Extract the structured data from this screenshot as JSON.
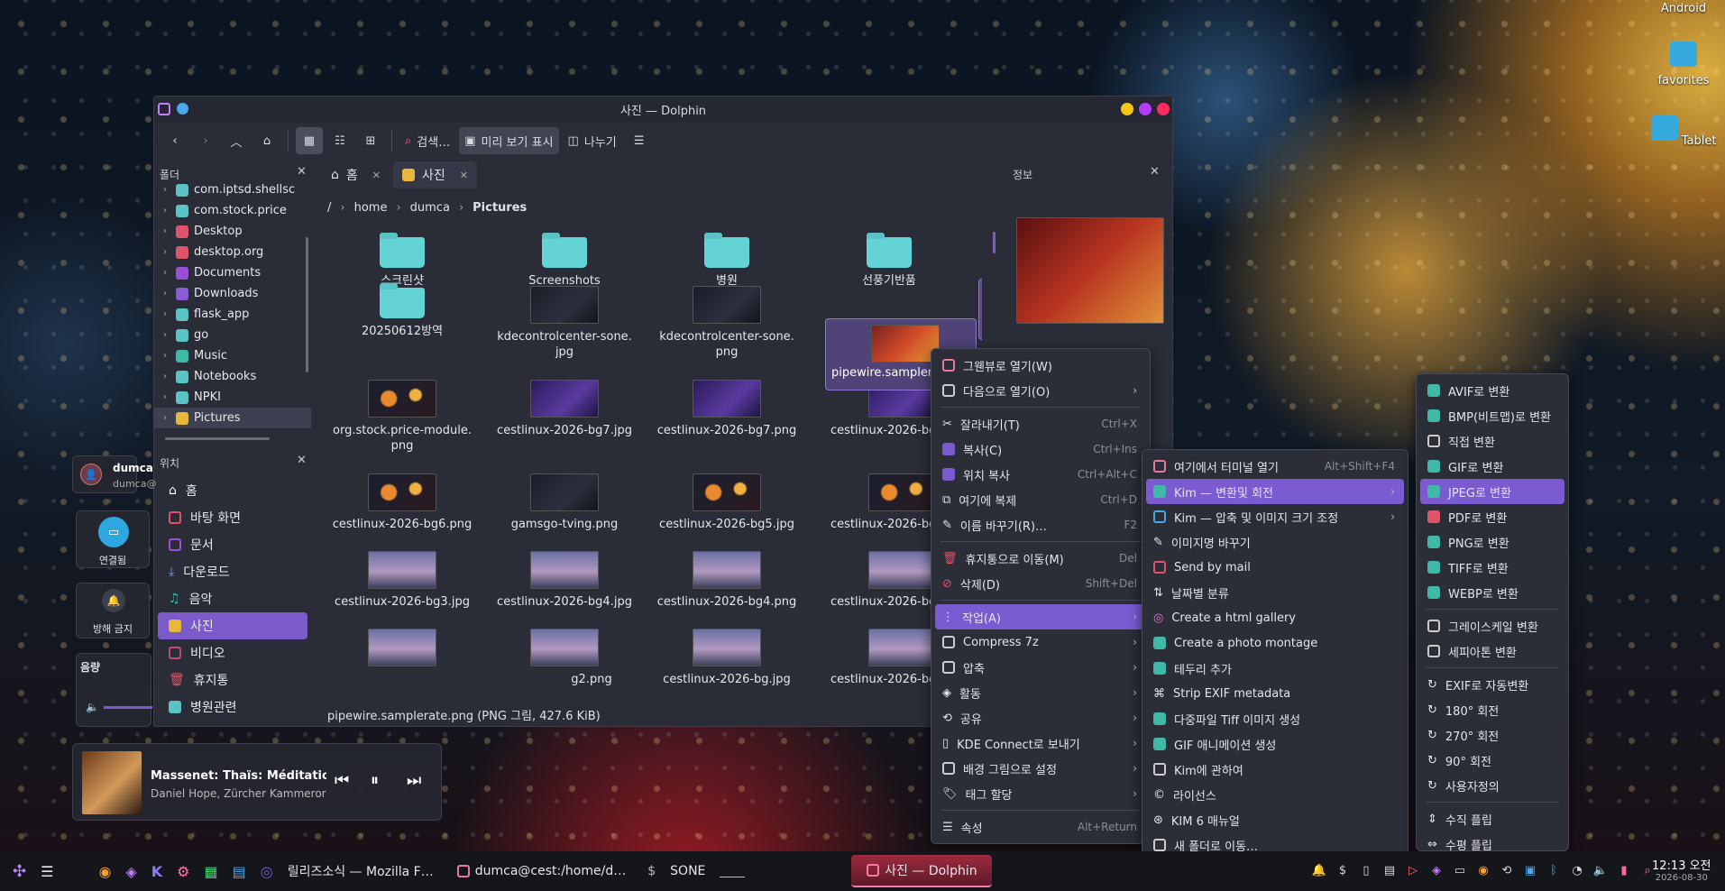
{
  "desktop": {
    "icons": [
      {
        "label": "Android"
      },
      {
        "label": "favorites"
      },
      {
        "label": "Tablet"
      }
    ]
  },
  "window": {
    "title": "사진 — Dolphin",
    "toolbar": {
      "search_label": "검색…",
      "preview_label": "미리 보기 표시",
      "split_label": "나누기"
    },
    "tabs": [
      {
        "label": "홈"
      },
      {
        "label": "사진"
      }
    ],
    "breadcrumb": [
      "/",
      "home",
      "dumca",
      "Pictures"
    ],
    "folders_panel": {
      "title": "폴더",
      "items": [
        {
          "label": "com.iptsd.shellsc"
        },
        {
          "label": "com.stock.price"
        },
        {
          "label": "Desktop"
        },
        {
          "label": "desktop.org"
        },
        {
          "label": "Documents"
        },
        {
          "label": "Downloads"
        },
        {
          "label": "flask_app"
        },
        {
          "label": "go"
        },
        {
          "label": "Music"
        },
        {
          "label": "Notebooks"
        },
        {
          "label": "NPKI"
        },
        {
          "label": "Pictures"
        }
      ]
    },
    "places_panel": {
      "title": "위치",
      "items": [
        {
          "label": "홈"
        },
        {
          "label": "바탕 화면"
        },
        {
          "label": "문서"
        },
        {
          "label": "다운로드"
        },
        {
          "label": "음악"
        },
        {
          "label": "사진"
        },
        {
          "label": "비디오"
        },
        {
          "label": "휴지통"
        },
        {
          "label": "병원관련"
        }
      ]
    },
    "files": [
      {
        "name": "스크린샷"
      },
      {
        "name": "Screenshots"
      },
      {
        "name": "병원"
      },
      {
        "name": "선풍기반품"
      },
      {
        "name": "20250612방역"
      },
      {
        "name": "kdecontrolcenter-sone.\njpg"
      },
      {
        "name": "kdecontrolcenter-sone.\npng"
      },
      {
        "name": "pipewire.samplera"
      },
      {
        "name": "org.stock.price-module.\npng"
      },
      {
        "name": "cestlinux-2026-bg7.jpg"
      },
      {
        "name": "cestlinux-2026-bg7.png"
      },
      {
        "name": "cestlinux-2026-bg"
      },
      {
        "name": "cestlinux-2026-bg6.png"
      },
      {
        "name": "gamsgo-tving.png"
      },
      {
        "name": "cestlinux-2026-bg5.jpg"
      },
      {
        "name": "cestlinux-2026-bg"
      },
      {
        "name": "cestlinux-2026-bg3.jpg"
      },
      {
        "name": "cestlinux-2026-bg4.jpg"
      },
      {
        "name": "cestlinux-2026-bg4.png"
      },
      {
        "name": "cestlinux-2026-bg"
      },
      {
        "name": "g2.png"
      },
      {
        "name": "cestlinux-2026-bg.jpg"
      },
      {
        "name": "cestlinux-2026-bg"
      }
    ],
    "status": "pipewire.samplerate.png (PNG 그림, 427.6 KiB)",
    "info_panel": {
      "title": "정보",
      "filename_fragment": "e."
    }
  },
  "widgets": {
    "user": {
      "name": "dumca",
      "email": "dumca@"
    },
    "connect_label": "연결됨",
    "dnd_label": "방해 금지",
    "volume_label": "음량",
    "media": {
      "title": "Massenet: Thaïs: Méditation (Ar…",
      "artist": "Daniel Hope, Zürcher Kammerorc…"
    }
  },
  "context_menu": {
    "items": [
      {
        "label": "그웬뷰로 열기(W)",
        "shortcut": "",
        "submenu": false
      },
      {
        "label": "다음으로 열기(O)",
        "shortcut": "",
        "submenu": true
      },
      {
        "label": "잘라내기(T)",
        "shortcut": "Ctrl+X",
        "submenu": false
      },
      {
        "label": "복사(C)",
        "shortcut": "Ctrl+Ins",
        "submenu": false
      },
      {
        "label": "위치 복사",
        "shortcut": "Ctrl+Alt+C",
        "submenu": false
      },
      {
        "label": "여기에 복제",
        "shortcut": "Ctrl+D",
        "submenu": false
      },
      {
        "label": "이름 바꾸기(R)…",
        "shortcut": "F2",
        "submenu": false
      },
      {
        "label": "휴지통으로 이동(M)",
        "shortcut": "Del",
        "submenu": false
      },
      {
        "label": "삭제(D)",
        "shortcut": "Shift+Del",
        "submenu": false
      },
      {
        "label": "작업(A)",
        "shortcut": "",
        "submenu": true
      },
      {
        "label": "Compress 7z",
        "shortcut": "",
        "submenu": true
      },
      {
        "label": "압축",
        "shortcut": "",
        "submenu": true
      },
      {
        "label": "활동",
        "shortcut": "",
        "submenu": true
      },
      {
        "label": "공유",
        "shortcut": "",
        "submenu": true
      },
      {
        "label": "KDE Connect로 보내기",
        "shortcut": "",
        "submenu": true
      },
      {
        "label": "배경 그림으로 설정",
        "shortcut": "",
        "submenu": true
      },
      {
        "label": "태그 할당",
        "shortcut": "",
        "submenu": true
      },
      {
        "label": "속성",
        "shortcut": "Alt+Return",
        "submenu": false
      }
    ]
  },
  "actions_menu": {
    "items": [
      {
        "label": "여기에서 터미널 열기",
        "shortcut": "Alt+Shift+F4"
      },
      {
        "label": "Kim — 변환및 회전",
        "shortcut": ""
      },
      {
        "label": "Kim — 압축 및 이미지 크기 조정",
        "shortcut": ""
      },
      {
        "label": "이미지명 바꾸기",
        "shortcut": ""
      },
      {
        "label": "Send by mail",
        "shortcut": ""
      },
      {
        "label": "날짜별 분류",
        "shortcut": ""
      },
      {
        "label": "Create a html gallery",
        "shortcut": ""
      },
      {
        "label": "Create a photo montage",
        "shortcut": ""
      },
      {
        "label": "테두리 추가",
        "shortcut": ""
      },
      {
        "label": "Strip EXIF metadata",
        "shortcut": ""
      },
      {
        "label": "다중파일 Tiff 이미지 생성",
        "shortcut": ""
      },
      {
        "label": "GIF 애니메이션 생성",
        "shortcut": ""
      },
      {
        "label": "Kim에 관하여",
        "shortcut": ""
      },
      {
        "label": "라이선스",
        "shortcut": ""
      },
      {
        "label": "KIM 6 매뉴얼",
        "shortcut": ""
      },
      {
        "label": "새 폴더로 이동…",
        "shortcut": ""
      }
    ]
  },
  "convert_menu": {
    "items": [
      {
        "label": "AVIF로 변환"
      },
      {
        "label": "BMP(비트맵)로 변환"
      },
      {
        "label": "직접 변환"
      },
      {
        "label": "GIF로 변환"
      },
      {
        "label": "JPEG로 변환"
      },
      {
        "label": "PDF로 변환"
      },
      {
        "label": "PNG로 변환"
      },
      {
        "label": "TIFF로 변환"
      },
      {
        "label": "WEBP로 변환"
      },
      {
        "label": "그레이스케일 변환"
      },
      {
        "label": "세피아톤 변환"
      },
      {
        "label": "EXIF로 자동변환"
      },
      {
        "label": "180° 회전"
      },
      {
        "label": "270° 회전"
      },
      {
        "label": "90° 회전"
      },
      {
        "label": "사용자정의"
      },
      {
        "label": "수직 플립"
      },
      {
        "label": "수평 플립"
      }
    ]
  },
  "taskbar": {
    "tasks": [
      {
        "label": "릴리즈소식 — Mozilla F…"
      },
      {
        "label": "dumca@cest:/home/d…"
      },
      {
        "label": "SONE"
      },
      {
        "label": "사진 — Dolphin"
      }
    ],
    "clock": {
      "time": "12:13 오전",
      "date": "2026-08-30"
    }
  },
  "colors": {
    "accent": "#7a5bd0",
    "folder": "#64d3d6",
    "taskbar_active": "#9e2a3d"
  }
}
